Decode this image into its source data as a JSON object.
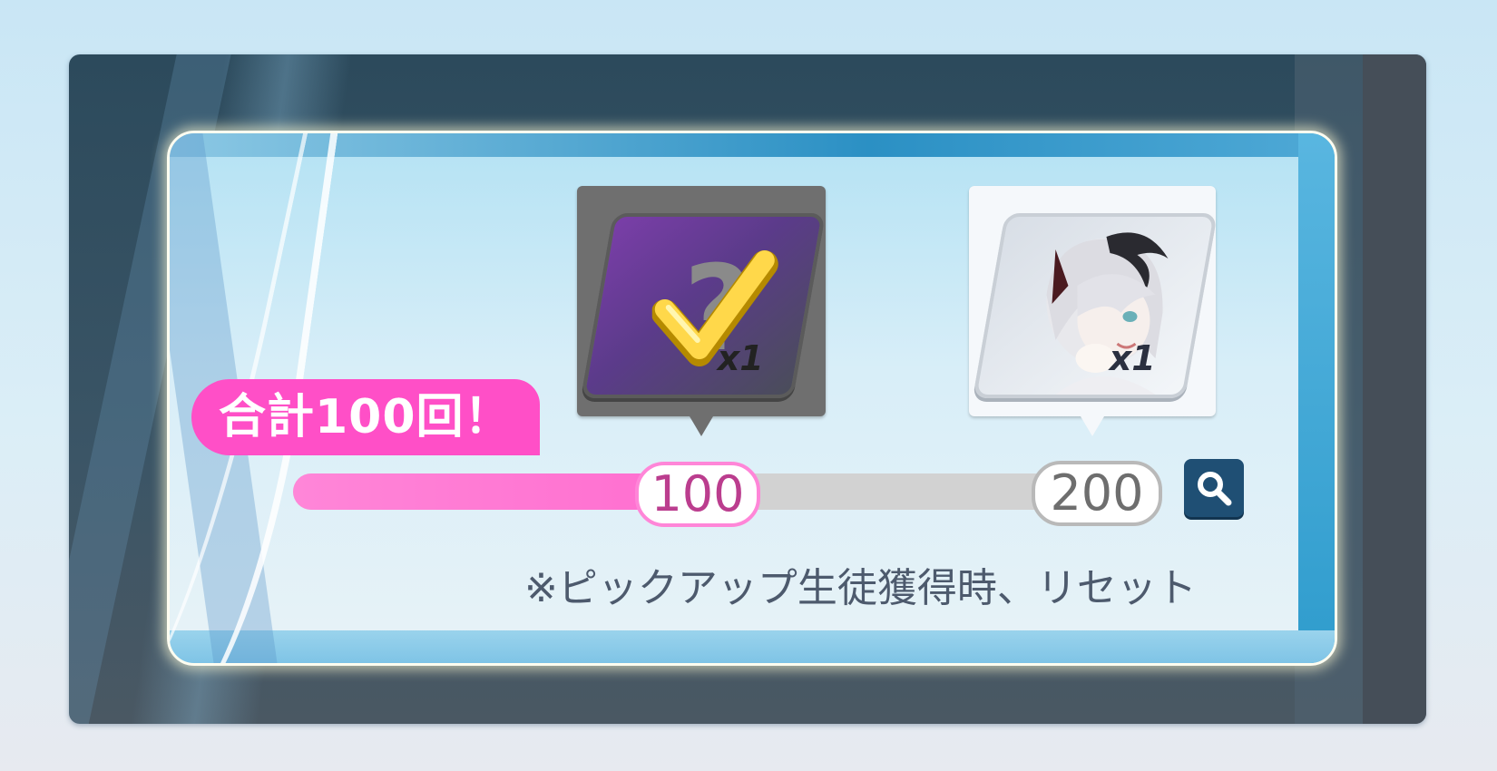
{
  "gacha_counter": {
    "total_label": "合計100回！",
    "rewards": [
      {
        "milestone": 100,
        "quantity": "x1",
        "icon": "selection-ticket-check-icon",
        "status": "reached"
      },
      {
        "milestone": 200,
        "quantity": "x1",
        "icon": "student-portrait",
        "status": "locked"
      }
    ],
    "progress": {
      "current": 100,
      "max": 200
    },
    "milestone_labels": [
      "100",
      "200"
    ],
    "search_icon": "search-icon",
    "reset_note": "※ピックアップ生徒獲得時、リセット"
  },
  "colors": {
    "accent_pink": "#ff4fc7",
    "progress_fill": "#ff7fd4",
    "track": "#d2d2d2",
    "search_button": "#1f4f74"
  }
}
